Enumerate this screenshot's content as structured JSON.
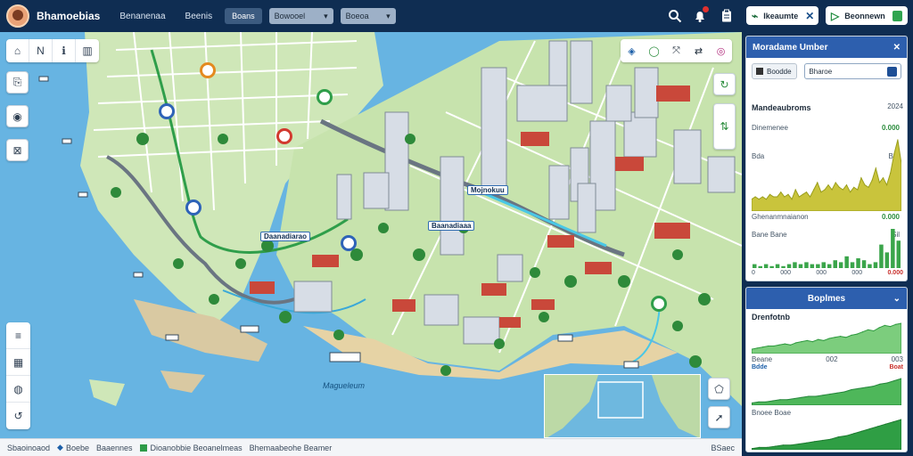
{
  "header": {
    "app_title": "Bhamoebias",
    "nav": [
      "Benanenaa",
      "Beenis"
    ],
    "active_button": "Boans",
    "select_one": "Bowooel",
    "select_two": "Boeoa",
    "filter_button": "Ikeaumte",
    "confirm_button": "Beonnewn",
    "icons": [
      "search-icon",
      "notification-icon",
      "clipboard-icon"
    ]
  },
  "map": {
    "labels": [
      "Daanadiarao",
      "Baanadiaaa",
      "Mojnokuu"
    ],
    "water_label": "Magueleum"
  },
  "statusbar": {
    "left": "Sbaoinoaod",
    "item1": "Boebe",
    "item2": "Baaennes",
    "item3": "Dioanobbie Beoanelmeas",
    "item4": "Bhemaabeohe Beamer",
    "right": "BSaec"
  },
  "panel": {
    "card1": {
      "title": "Moradame Umber",
      "select_value": "Boodde",
      "input_value": "Bharoe",
      "section_title": "Mandeaubroms",
      "section_value": "2024",
      "metric1_label": "Dinemenee",
      "metric1_value": "0.000",
      "small_label": "Bda",
      "small_value": "Bar",
      "chart1_caption": "Ghenanmnaianon",
      "chart1_value": "0.000",
      "chart2_caption": "Bane Bane",
      "chart2_value": "Sil",
      "axis_left": "0",
      "axis_ticks": [
        "000",
        "000",
        "000"
      ],
      "axis_right": "0.000"
    },
    "card2": {
      "title": "Boplmes",
      "label1": "Drenfotnb",
      "row1": [
        "Beane",
        "002",
        "003"
      ],
      "row1_values": [
        "Bdde",
        "Boat"
      ],
      "label2": "Bnoee Boae"
    }
  },
  "chart_data": [
    {
      "type": "area",
      "title": "Mandeaubroms",
      "values": [
        5,
        6,
        5,
        6,
        5,
        7,
        6,
        6,
        8,
        6,
        7,
        5,
        9,
        6,
        7,
        8,
        6,
        9,
        12,
        8,
        9,
        11,
        9,
        12,
        10,
        9,
        11,
        8,
        10,
        9,
        14,
        11,
        10,
        13,
        18,
        12,
        14,
        11,
        16,
        24,
        30,
        20
      ]
    },
    {
      "type": "bar",
      "title": "Bane Bane",
      "values": [
        2,
        1,
        2,
        1,
        2,
        1,
        2,
        3,
        2,
        3,
        2,
        2,
        3,
        2,
        4,
        3,
        6,
        3,
        5,
        4,
        2,
        3,
        12,
        8,
        20,
        14
      ]
    },
    {
      "type": "area",
      "title": "Boplmes",
      "values": [
        4,
        5,
        6,
        7,
        7,
        8,
        9,
        8,
        10,
        11,
        12,
        11,
        13,
        12,
        14,
        15,
        16,
        15,
        17,
        18,
        20,
        22,
        21,
        24,
        26,
        25,
        27,
        28
      ]
    },
    {
      "type": "area",
      "title": "Drenfotnb",
      "values": [
        2,
        3,
        3,
        4,
        5,
        5,
        6,
        7,
        8,
        8,
        9,
        10,
        11,
        12,
        14,
        15,
        16,
        17,
        19,
        20,
        22,
        24
      ]
    },
    {
      "type": "area",
      "title": "Bnoee Boae",
      "values": [
        1,
        2,
        2,
        3,
        4,
        4,
        5,
        6,
        7,
        8,
        9,
        11,
        12,
        14,
        16,
        18,
        20,
        22,
        24,
        26
      ]
    }
  ]
}
